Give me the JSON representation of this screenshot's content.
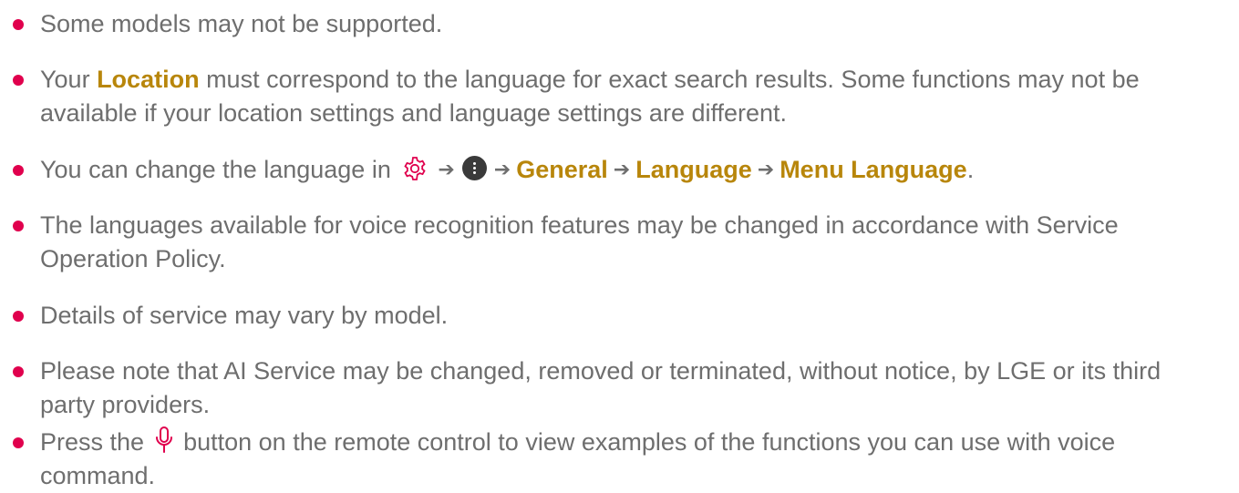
{
  "notes": [
    {
      "text": "Some models may not be supported."
    },
    {
      "pre": "Your ",
      "kw": "Location",
      "post": " must correspond to the language for exact search results. Some functions may not be available if your location settings and language settings are different."
    },
    {
      "pre": "You can change the language in",
      "icon1": "settings-gear-icon",
      "icon2": "more-options-icon",
      "path": [
        "General",
        "Language",
        "Menu Language"
      ],
      "post": "."
    },
    {
      "text": "The languages available for voice recognition features may be changed in accordance with Service Operation Policy."
    },
    {
      "text": "Details of service may vary by model."
    },
    {
      "text": "Please note that AI Service may be changed, removed or terminated, without notice, by LGE or its third party providers."
    },
    {
      "pre": "Press the",
      "icon": "microphone-icon",
      "post": "button on the remote control to view examples of the functions you can use with voice command."
    }
  ],
  "colors": {
    "bullet": "#e0004d",
    "keyword": "#b8860b",
    "text": "#6e6e6e",
    "mic": "#e0004d"
  }
}
